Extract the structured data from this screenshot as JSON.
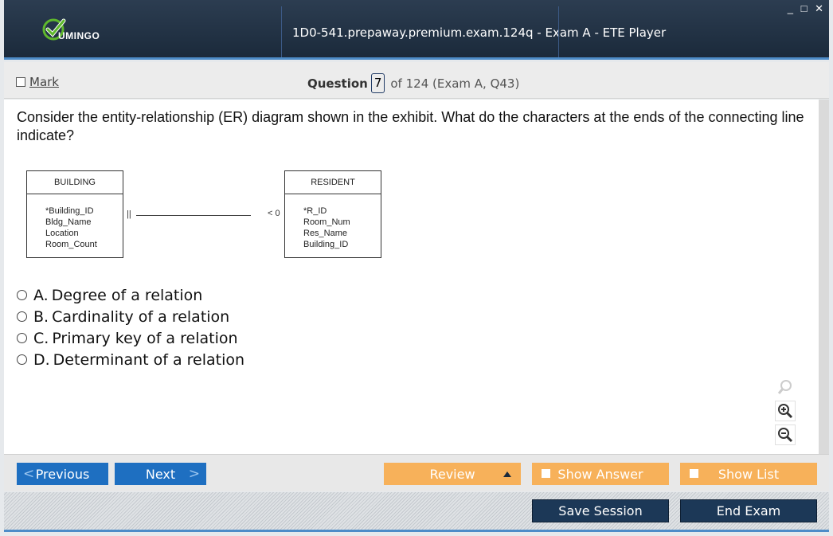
{
  "app": {
    "logo_text": "UMINGO",
    "title": "1D0-541.prepaway.premium.exam.124q - Exam A - ETE Player",
    "window_controls": "_ □ ✕"
  },
  "header": {
    "mark_label": "Mark",
    "question_label": "Question",
    "question_number": "7",
    "question_of": "of 124 (Exam A, Q43)"
  },
  "question": {
    "text": "Consider the entity-relationship (ER) diagram shown in the exhibit. What do the characters at the ends of the connecting line indicate?",
    "exhibit": {
      "left_entity": {
        "name": "BUILDING",
        "attributes": [
          "*Building_ID",
          "Bldg_Name",
          "Location",
          "Room_Count"
        ]
      },
      "right_entity": {
        "name": "RESIDENT",
        "attributes": [
          "*R_ID",
          "Room_Num",
          "Res_Name",
          "Building_ID"
        ]
      },
      "left_end_symbol": "||",
      "right_end_symbol": "< 0"
    },
    "options": [
      {
        "letter": "A.",
        "text": "Degree of a relation"
      },
      {
        "letter": "B.",
        "text": "Cardinality of a relation"
      },
      {
        "letter": "C.",
        "text": "Primary key of a relation"
      },
      {
        "letter": "D.",
        "text": "Determinant of a relation"
      }
    ]
  },
  "zoom_icons": [
    "magnifier-icon",
    "zoom-in-icon",
    "zoom-out-icon"
  ],
  "nav": {
    "previous_label": "Previous",
    "next_label": "Next",
    "review_label": "Review",
    "show_answer_label": "Show Answer",
    "show_list_label": "Show List"
  },
  "footer": {
    "save_label": "Save Session",
    "end_label": "End Exam"
  },
  "colors": {
    "title_bg": "#1b2a3b",
    "accent_blue": "#1e6fc1",
    "accent_orange": "#f7b15a",
    "dark_button": "#1c3857",
    "logo_green": "#5fb82d"
  }
}
